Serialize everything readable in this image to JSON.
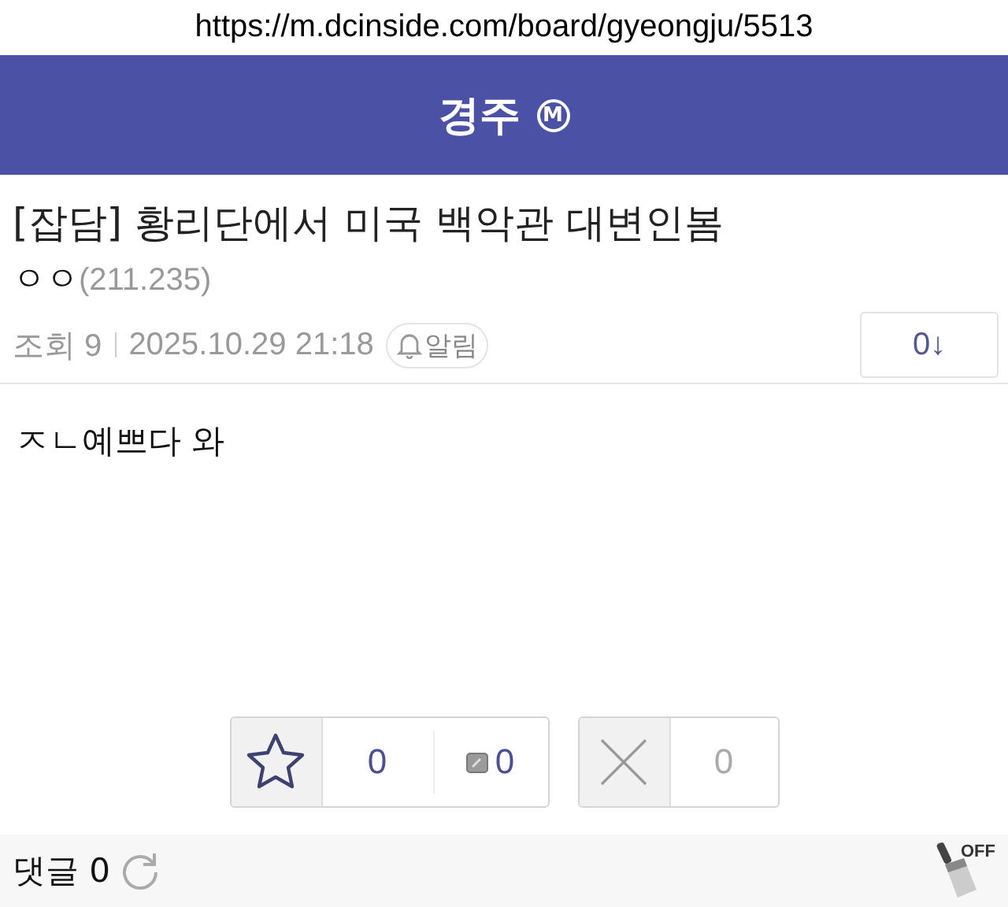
{
  "address_bar": {
    "url": "https://m.dcinside.com/board/gyeongju/5513"
  },
  "board": {
    "title": "경주",
    "badge": "M"
  },
  "post": {
    "title": "[잡담] 황리단에서 미국 백악관 대변인봄",
    "author": "ㅇㅇ",
    "ip": "(211.235)",
    "views": "조회 9",
    "date": "2025.10.29 21:18",
    "alert_label": "알림",
    "comment_jump": "0↓",
    "body": "ㅈㄴ예쁘다 와"
  },
  "votes": {
    "up_count": "0",
    "fixed_up_count": "0",
    "down_count": "0"
  },
  "comments": {
    "label": "댓글 0"
  },
  "clean_bot": {
    "label": "OFF"
  }
}
